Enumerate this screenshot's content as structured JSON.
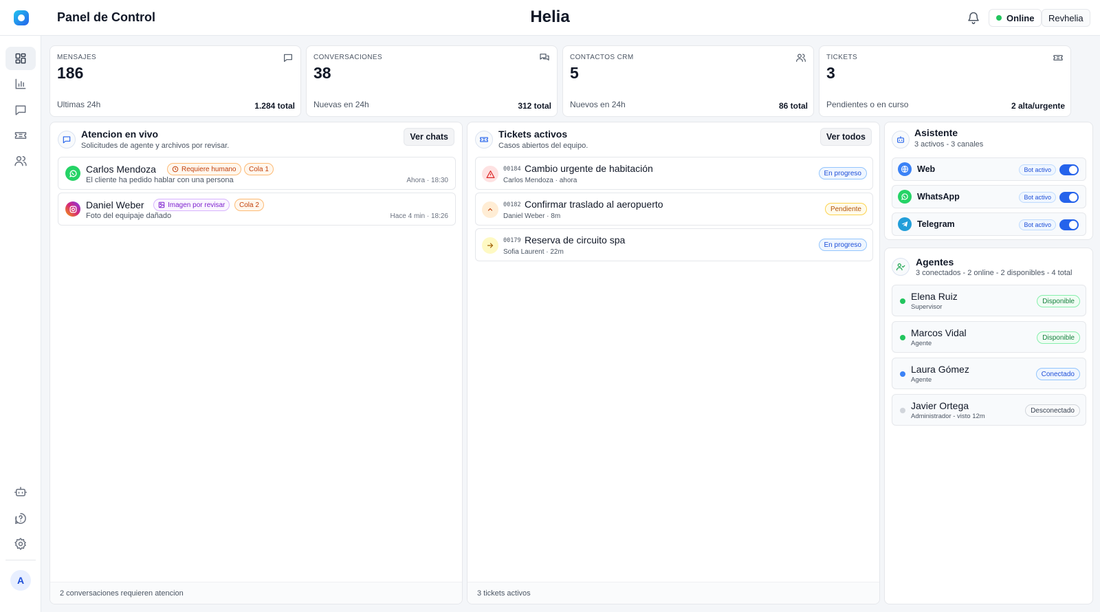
{
  "header": {
    "page_title": "Panel de Control",
    "brand": "Helia",
    "status_label": "Online",
    "user_label": "Revhelia"
  },
  "sidebar": {
    "items": [
      {
        "icon": "dashboard-icon",
        "active": true
      },
      {
        "icon": "chart-icon"
      },
      {
        "icon": "chat-icon"
      },
      {
        "icon": "ticket-icon"
      },
      {
        "icon": "users-icon"
      }
    ],
    "bottom_items": [
      {
        "icon": "bot-icon"
      },
      {
        "icon": "help-icon"
      },
      {
        "icon": "settings-icon"
      }
    ],
    "avatar_initial": "A"
  },
  "stats": [
    {
      "label": "MENSAJES",
      "value": "186",
      "sub": "Ultimas 24h",
      "total": "1.284 total",
      "icon": "message-icon"
    },
    {
      "label": "CONVERSACIONES",
      "value": "38",
      "sub": "Nuevas en 24h",
      "total": "312 total",
      "icon": "conversations-icon"
    },
    {
      "label": "CONTACTOS CRM",
      "value": "5",
      "sub": "Nuevos en 24h",
      "total": "86 total",
      "icon": "contacts-icon"
    },
    {
      "label": "TICKETS",
      "value": "3",
      "sub": "Pendientes o en curso",
      "total": "2 alta/urgente",
      "icon": "ticket-icon"
    }
  ],
  "live": {
    "title": "Atencion en vivo",
    "subtitle": "Solicitudes de agente y archivos por revisar.",
    "button": "Ver chats",
    "items": [
      {
        "name": "Carlos Mendoza",
        "tag": "Requiere humano",
        "queue": "Cola 1",
        "desc": "El cliente ha pedido hablar con una persona",
        "time": "Ahora · 18:30",
        "channel": "whatsapp"
      },
      {
        "name": "Daniel Weber",
        "tag": "Imagen por revisar",
        "queue": "Cola 2",
        "desc": "Foto del equipaje dañado",
        "time": "Hace 4 min · 18:26",
        "channel": "instagram"
      }
    ],
    "footer": "2 conversaciones requieren atencion"
  },
  "tickets": {
    "title": "Tickets activos",
    "subtitle": "Casos abiertos del equipo.",
    "button": "Ver todos",
    "items": [
      {
        "code": "00184",
        "name": "Cambio urgente de habitación",
        "meta": "Carlos Mendoza · ahora",
        "status": "En progreso",
        "priority_icon": "alert-icon"
      },
      {
        "code": "00182",
        "name": "Confirmar traslado al aeropuerto",
        "meta": "Daniel Weber · 8m",
        "status": "Pendiente",
        "priority_icon": "chevron-up-icon"
      },
      {
        "code": "00179",
        "name": "Reserva de circuito spa",
        "meta": "Sofia Laurent · 22m",
        "status": "En progreso",
        "priority_icon": "arrow-right-icon"
      }
    ],
    "footer": "3 tickets activos"
  },
  "assistant": {
    "title": "Asistente",
    "subtitle": "3 activos - 3 canales",
    "channels": [
      {
        "name": "Web",
        "badge": "Bot activo",
        "icon": "globe-icon",
        "enabled": true
      },
      {
        "name": "WhatsApp",
        "badge": "Bot activo",
        "icon": "whatsapp-icon",
        "enabled": true
      },
      {
        "name": "Telegram",
        "badge": "Bot activo",
        "icon": "telegram-icon",
        "enabled": true
      }
    ]
  },
  "agents": {
    "title": "Agentes",
    "subtitle": "3 conectados - 2 online - 2 disponibles - 4 total",
    "items": [
      {
        "name": "Elena Ruiz",
        "role": "Supervisor",
        "status": "Disponible"
      },
      {
        "name": "Marcos Vidal",
        "role": "Agente",
        "status": "Disponible"
      },
      {
        "name": "Laura Gómez",
        "role": "Agente",
        "status": "Conectado"
      },
      {
        "name": "Javier Ortega",
        "role": "Administrador - visto 12m",
        "status": "Desconectado"
      }
    ]
  },
  "colors": {
    "accent": "#2563eb",
    "online": "#22c55e",
    "whatsapp": "#25d366",
    "telegram": "#229ed9",
    "instagram": "#d62976"
  }
}
